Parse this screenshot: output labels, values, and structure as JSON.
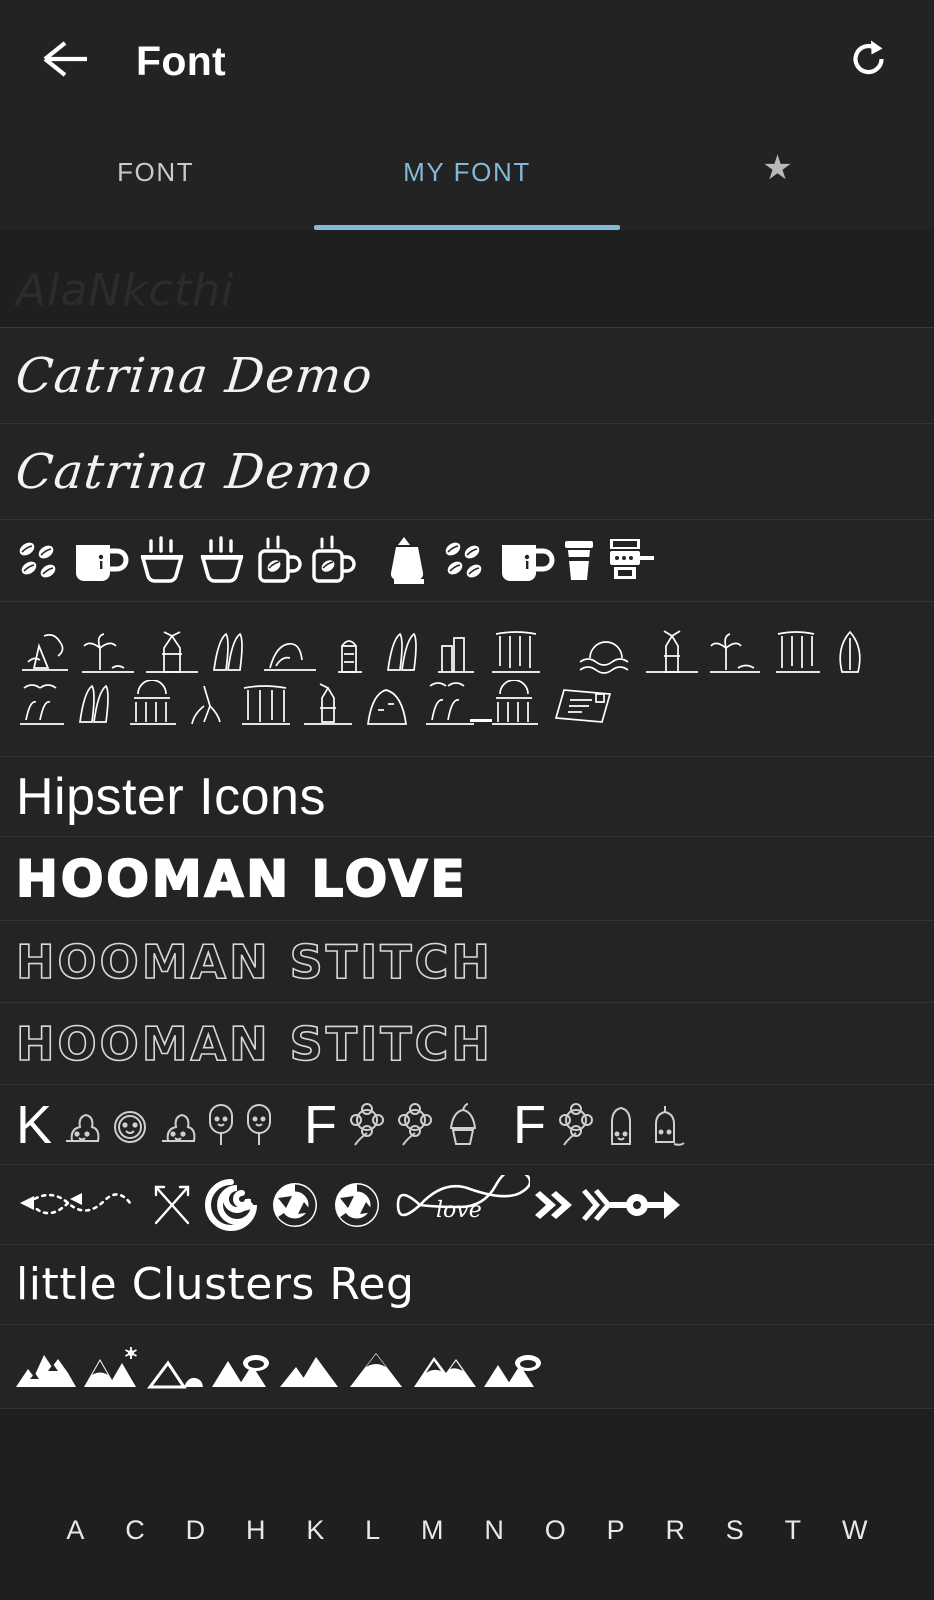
{
  "appbar": {
    "back_icon": "arrow-left-icon",
    "title": "Font",
    "refresh_icon": "refresh-icon"
  },
  "tabs": [
    {
      "label": "FONT",
      "active": false
    },
    {
      "label": "MY FONT",
      "active": true
    },
    {
      "label": "★",
      "active": false,
      "icon": "star-icon"
    }
  ],
  "colors": {
    "background": "#1f1f1f",
    "row_background": "#242424",
    "appbar_background": "#232323",
    "divider": "#343434",
    "accent": "#82b9d6",
    "text_primary": "#ffffff",
    "text_inactive": "#c9c9c9",
    "dim_sample": "#2e2b29"
  },
  "font_list": [
    {
      "name": "AlaNkcthi",
      "style": "partial-dim",
      "kind": "text"
    },
    {
      "name": "Catrina Demo",
      "style": "script",
      "kind": "text"
    },
    {
      "name": "Catrina Demo",
      "style": "script",
      "kind": "text"
    },
    {
      "name": "Coffee Dingbats",
      "style": "dingbat",
      "kind": "icons"
    },
    {
      "name": "Nature Travel Doodles",
      "style": "dingbat",
      "kind": "icons"
    },
    {
      "name": "Hipster Icons",
      "style": "sans",
      "kind": "text"
    },
    {
      "name": "HOOMAN LOVE",
      "style": "fat",
      "kind": "text"
    },
    {
      "name": "HOOMAN STITCH",
      "style": "stitch",
      "kind": "text"
    },
    {
      "name": "HOOMAN STITCH",
      "style": "stitch",
      "kind": "text"
    },
    {
      "name": "Kawaii Dessert Icons",
      "style": "dingbat-mixed",
      "kind": "icons"
    },
    {
      "name": "Arrows & Infinity",
      "style": "dingbat",
      "kind": "icons"
    },
    {
      "name": "little Clusters Reg",
      "style": "marker",
      "kind": "text"
    },
    {
      "name": "Mountain Icons",
      "style": "dingbat",
      "kind": "icons"
    }
  ],
  "mixed_row_letters": {
    "k": "K",
    "f1": "F",
    "f2": "F"
  },
  "index_letters": [
    "A",
    "C",
    "D",
    "H",
    "K",
    "L",
    "M",
    "N",
    "O",
    "P",
    "R",
    "S",
    "T",
    "W"
  ]
}
